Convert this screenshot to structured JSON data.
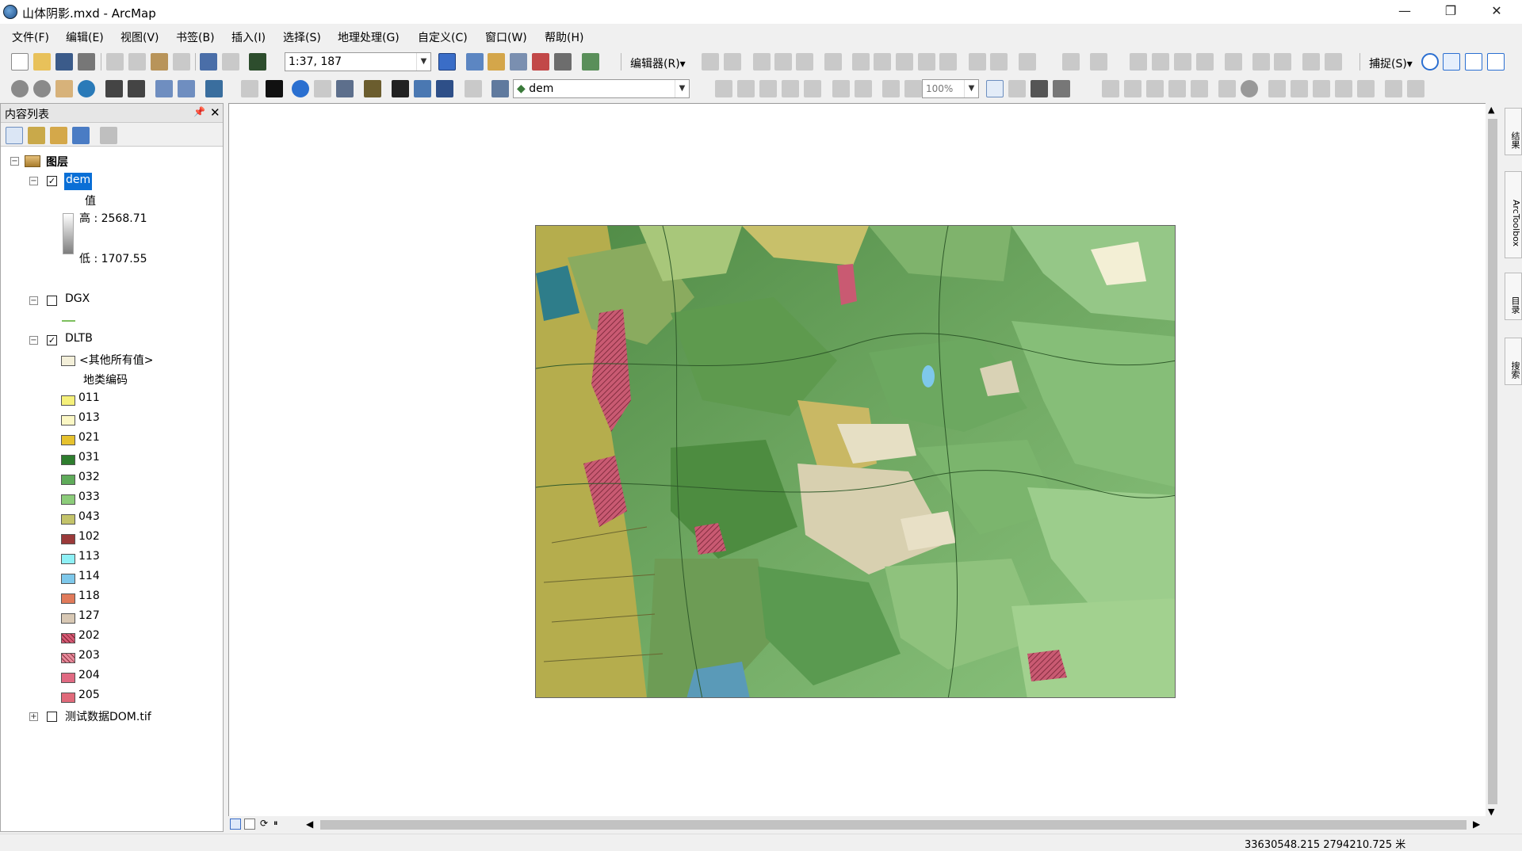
{
  "window": {
    "title": "山体阴影.mxd - ArcMap",
    "minimize": "—",
    "maximize": "❐",
    "close": "✕"
  },
  "menu": [
    "文件(F)",
    "编辑(E)",
    "视图(V)",
    "书签(B)",
    "插入(I)",
    "选择(S)",
    "地理处理(G)",
    "自定义(C)",
    "窗口(W)",
    "帮助(H)"
  ],
  "toolbar": {
    "scale_value": "1:37, 187",
    "editor_label": "编辑器(R)▾",
    "snapping_label": "捕捉(S)▾",
    "layer_combo": "dem",
    "zoom_percent": "100%"
  },
  "toc": {
    "title": "内容列表",
    "root_label": "图层",
    "layers": [
      {
        "name": "dem",
        "checked": true,
        "expanded": true,
        "selected": true,
        "legend_heading": "值",
        "high_label": "高 : 2568.71",
        "low_label": "低 : 1707.55"
      },
      {
        "name": "DGX",
        "checked": false,
        "expanded": true,
        "line_color": "#7dbf5e"
      },
      {
        "name": "DLTB",
        "checked": true,
        "expanded": true,
        "other_values_label": "<其他所有值>",
        "field_heading": "地类编码",
        "classes": [
          {
            "code": "011",
            "color": "#f5f07a"
          },
          {
            "code": "013",
            "color": "#fbf7c4"
          },
          {
            "code": "021",
            "color": "#e6c22e"
          },
          {
            "code": "031",
            "color": "#2e7d2e"
          },
          {
            "code": "032",
            "color": "#5fab5a"
          },
          {
            "code": "033",
            "color": "#8ccc7a"
          },
          {
            "code": "043",
            "color": "#c3c36a"
          },
          {
            "code": "102",
            "color": "#9b3a3a"
          },
          {
            "code": "113",
            "color": "#8ef0f5"
          },
          {
            "code": "114",
            "color": "#7ec8ea"
          },
          {
            "code": "118",
            "color": "#e07a5a"
          },
          {
            "code": "127",
            "color": "#d8c8b4"
          },
          {
            "code": "202",
            "color": "#d65a74"
          },
          {
            "code": "203",
            "color": "#e68a9a"
          },
          {
            "code": "204",
            "color": "#e06a82"
          },
          {
            "code": "205",
            "color": "#e06a7a"
          }
        ]
      },
      {
        "name": "测试数据DOM.tif",
        "checked": false,
        "expanded": false
      }
    ]
  },
  "right_dock": [
    "结果",
    "ArcToolbox",
    "目录",
    "搜索"
  ],
  "status": {
    "coordinates": "33630548.215  2794210.725 米"
  },
  "colors": {
    "selection": "#0a6fd6",
    "map_bg": "#ffffff"
  }
}
